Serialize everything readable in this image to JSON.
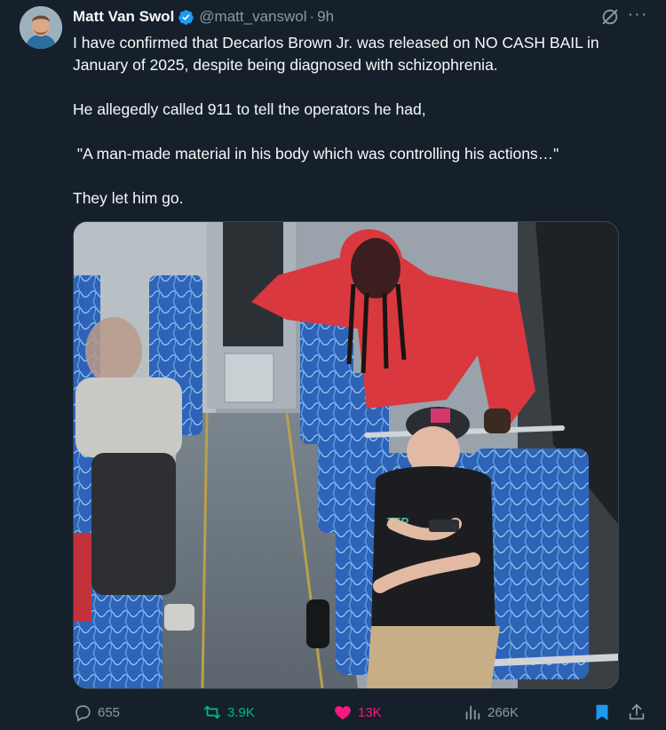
{
  "author": {
    "display_name": "Matt Van Swol",
    "handle": "@matt_vanswol",
    "separator": "·",
    "time": "9h",
    "verified": true
  },
  "tweet": {
    "lines": [
      "I have confirmed that Decarlos Brown Jr. was released on NO CASH BAIL in January of 2025, despite being diagnosed with schizophrenia.",
      "He allegedly called 911 to tell the operators he had,",
      " \"A man-made material in his body which was controlling his actions…\"",
      "They let him go."
    ]
  },
  "media": {
    "shirt_text": "ZEP"
  },
  "actions": {
    "replies": "655",
    "retweets": "3.9K",
    "likes": "13K",
    "views": "266K"
  },
  "colors": {
    "background": "#15202b",
    "text": "#f7f9f9",
    "secondary": "#8b98a5",
    "verified": "#1d9bf0",
    "retweet": "#00ba7c",
    "like": "#f91880"
  },
  "icons": [
    "verified-badge-icon",
    "grok-icon",
    "more-icon",
    "reply-icon",
    "retweet-icon",
    "like-icon",
    "views-icon",
    "bookmark-icon",
    "share-icon"
  ]
}
